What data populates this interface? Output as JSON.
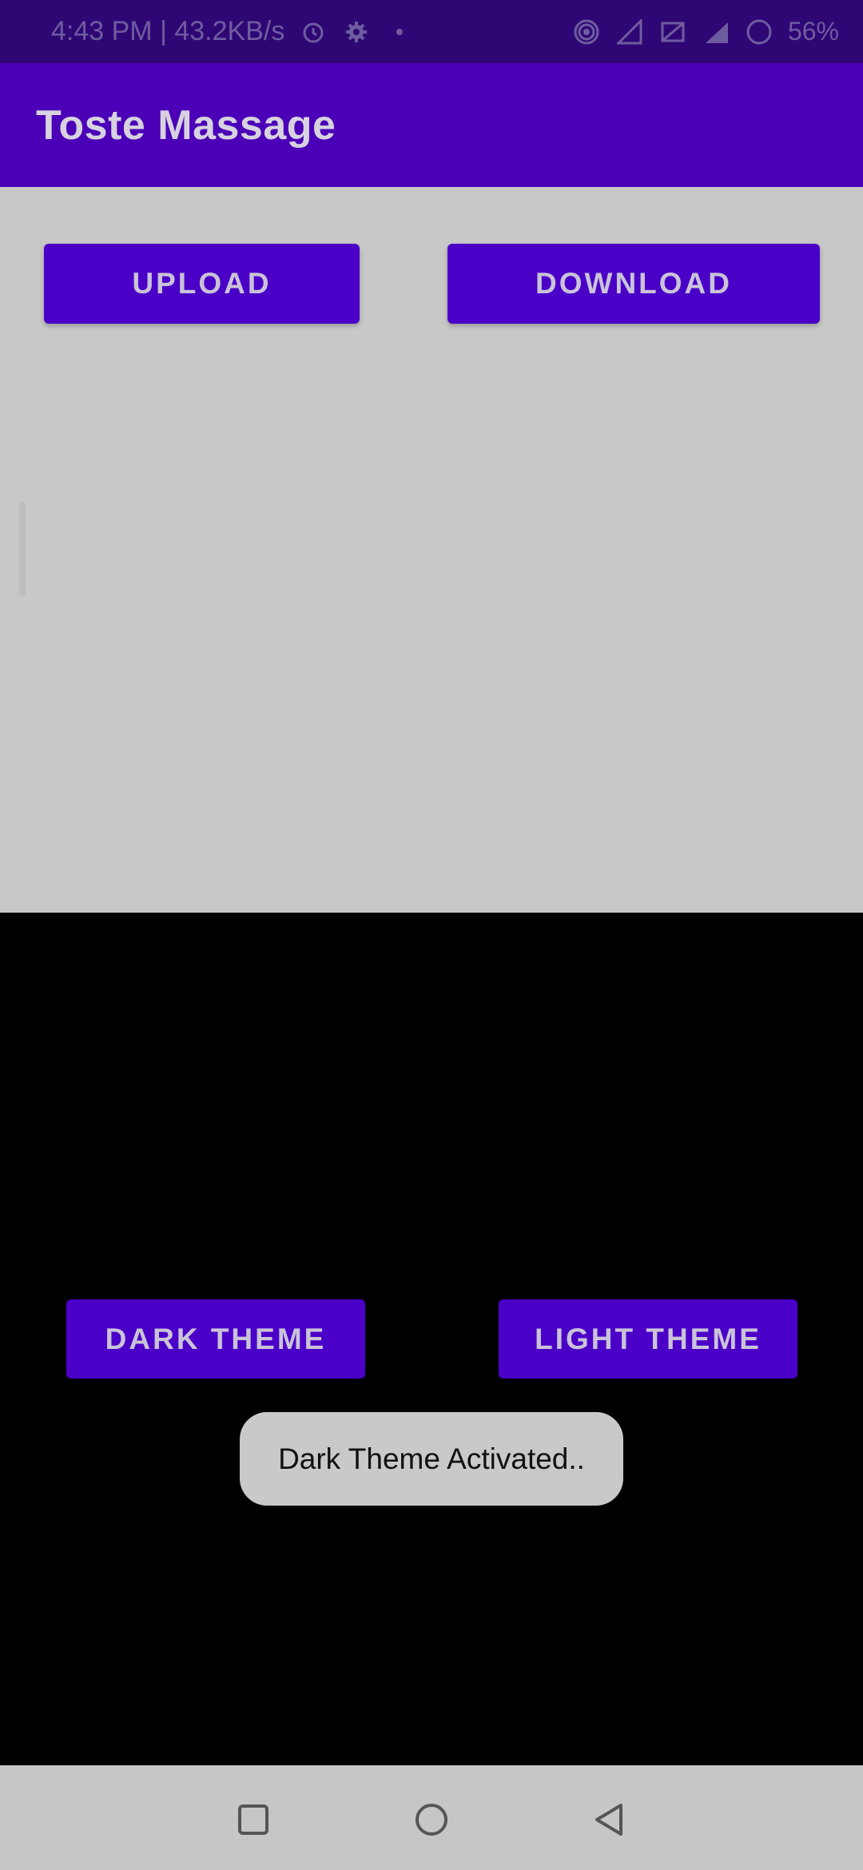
{
  "status_bar": {
    "time_speed": "4:43 PM | 43.2KB/s",
    "battery_percent": "56%",
    "icons": [
      "alarm-icon",
      "settings-gear-icon",
      "dot-icon",
      "hotspot-icon",
      "signal-icon",
      "data-saver-icon",
      "4g-signal-icon",
      "battery-icon"
    ]
  },
  "app_bar": {
    "title": "Toste Massage"
  },
  "buttons": {
    "upload": "UPLOAD",
    "download": "DOWNLOAD",
    "dark_theme": "DARK THEME",
    "light_theme": "LIGHT THEME"
  },
  "toast": {
    "message": "Dark Theme Activated.."
  },
  "nav_bar": {
    "icons": [
      "recents-square-icon",
      "home-circle-icon",
      "back-triangle-icon"
    ]
  },
  "colors": {
    "status_bar": "#2f0775",
    "app_bar": "#4b00b8",
    "button": "#4b00c8",
    "light_area": "#c8c8c8",
    "dark_area": "#000000"
  }
}
